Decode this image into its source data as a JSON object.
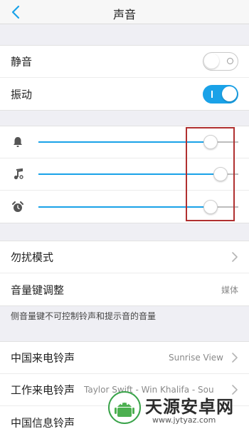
{
  "header": {
    "title": "声音",
    "back_icon": "chevron-left-icon"
  },
  "toggles": {
    "silent": {
      "label": "静音",
      "on": false
    },
    "vibrate": {
      "label": "振动",
      "on": true
    }
  },
  "volume": {
    "ringer": {
      "icon": "bell-icon",
      "level": 0.86
    },
    "media": {
      "icon": "music-note-icon",
      "level": 0.91
    },
    "alarm": {
      "icon": "alarm-clock-icon",
      "level": 0.86
    }
  },
  "settings": {
    "dnd_label": "勿扰模式",
    "volume_key_label": "音量键调整",
    "volume_key_value": "媒体",
    "note": "侧音量键不可控制铃声和提示音的音量"
  },
  "ringtones": {
    "china_call_label": "中国来电铃声",
    "china_call_value": "Sunrise View",
    "work_call_label": "工作来电铃声",
    "work_call_value": "Taylor Swift - Win Khalifa - Sou",
    "china_msg_label": "中国信息铃声"
  },
  "watermark": {
    "title": "天源安卓网",
    "url": "www.jytyaz.com"
  },
  "colors": {
    "accent": "#1aa2e8",
    "highlight": "#b03030"
  }
}
